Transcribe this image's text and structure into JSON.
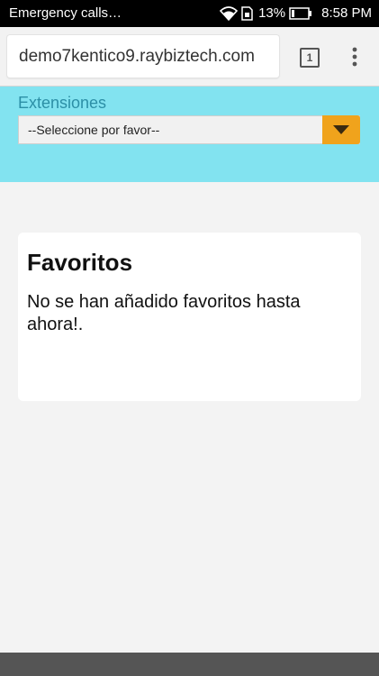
{
  "status_bar": {
    "carrier": "Emergency calls…",
    "battery": "13%",
    "time": "8:58 PM",
    "icons": [
      "wifi-icon",
      "sim-icon",
      "battery-icon"
    ]
  },
  "browser": {
    "url": "demo7kentico9.raybiztech.com",
    "tab_count": "1",
    "menu_icon": "overflow-menu-icon"
  },
  "extensions": {
    "label": "Extensiones",
    "selected": "--Seleccione por favor--",
    "dropdown_icon": "caret-down-icon"
  },
  "favorites": {
    "title": "Favoritos",
    "message": "No se han añadido favoritos hasta ahora!."
  },
  "colors": {
    "panel": "#82e3f0",
    "label": "#2c8fa6",
    "dropdown_button": "#f0a31c",
    "bottom_bar": "#555555"
  }
}
